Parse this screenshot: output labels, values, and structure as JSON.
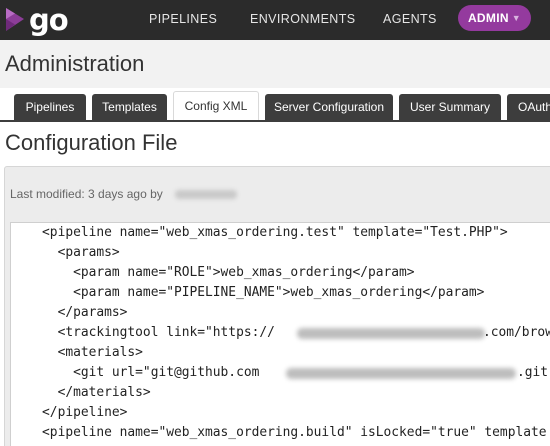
{
  "nav": {
    "logo_text": "go",
    "items": [
      "PIPELINES",
      "ENVIRONMENTS",
      "AGENTS"
    ],
    "admin_label": "ADMIN",
    "admin_color": "#943a9e"
  },
  "page": {
    "title": "Administration"
  },
  "tabs": [
    {
      "label": "Pipelines",
      "active": false
    },
    {
      "label": "Templates",
      "active": false
    },
    {
      "label": "Config XML",
      "active": true
    },
    {
      "label": "Server Configuration",
      "active": false
    },
    {
      "label": "User Summary",
      "active": false
    },
    {
      "label": "OAuth",
      "active": false
    }
  ],
  "config": {
    "title": "Configuration File",
    "last_modified": "Last modified: 3 days ago by",
    "lines": [
      "    <pipeline name=\"web_xmas_ordering.test\" template=\"Test.PHP\">",
      "      <params>",
      "        <param name=\"ROLE\">web_xmas_ordering</param>",
      "        <param name=\"PIPELINE_NAME\">web_xmas_ordering</param>",
      "      </params>",
      "      <trackingtool link=\"https://",
      "      <materials>",
      "        <git url=\"git@github.com",
      "      </materials>",
      "    </pipeline>",
      "    <pipeline name=\"web_xmas_ordering.build\" isLocked=\"true\" template"
    ],
    "tracking_suffix": ".com/brow",
    "git_suffix": ".git\""
  }
}
